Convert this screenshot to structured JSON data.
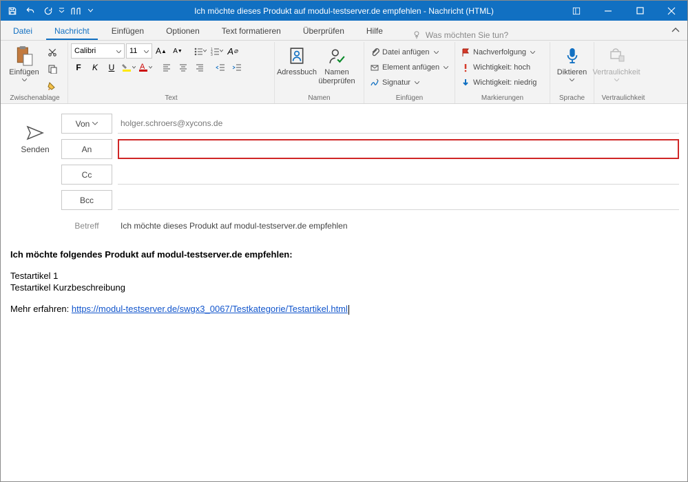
{
  "title": "Ich möchte dieses Produkt auf modul-testserver.de empfehlen  -  Nachricht (HTML)",
  "tabs": {
    "file": "Datei",
    "message": "Nachricht",
    "insert": "Einfügen",
    "options": "Optionen",
    "format": "Text formatieren",
    "review": "Überprüfen",
    "help": "Hilfe"
  },
  "tellme_placeholder": "Was möchten Sie tun?",
  "ribbon": {
    "clipboard": {
      "paste": "Einfügen",
      "group": "Zwischenablage"
    },
    "text": {
      "group": "Text",
      "font_name": "Calibri",
      "font_size": "11"
    },
    "names": {
      "group": "Namen",
      "addressbook": "Adressbuch",
      "checknames": "Namen überprüfen"
    },
    "include": {
      "group": "Einfügen",
      "attach_file": "Datei anfügen",
      "attach_item": "Element anfügen",
      "signature": "Signatur"
    },
    "tags": {
      "group": "Markierungen",
      "followup": "Nachverfolgung",
      "high": "Wichtigkeit: hoch",
      "low": "Wichtigkeit: niedrig"
    },
    "voice": {
      "group": "Sprache",
      "dictate": "Diktieren"
    },
    "sensitivity": {
      "group": "Vertraulichkeit",
      "label": "Vertraulichkeit"
    }
  },
  "compose": {
    "send": "Senden",
    "from_btn": "Von",
    "from_value": "holger.schroers@xycons.de",
    "to_btn": "An",
    "to_value": "",
    "cc_btn": "Cc",
    "cc_value": "",
    "bcc_btn": "Bcc",
    "bcc_value": "",
    "subject_label": "Betreff",
    "subject_value": "Ich möchte dieses Produkt auf modul-testserver.de empfehlen"
  },
  "body": {
    "lead": "Ich möchte folgendes Produkt auf modul-testserver.de empfehlen:",
    "line1": "Testartikel 1",
    "line2": "Testartikel Kurzbeschreibung",
    "learn_more": "Mehr erfahren: ",
    "link_text": "https://modul-testserver.de/swgx3_0067/Testkategorie/Testartikel.html"
  }
}
